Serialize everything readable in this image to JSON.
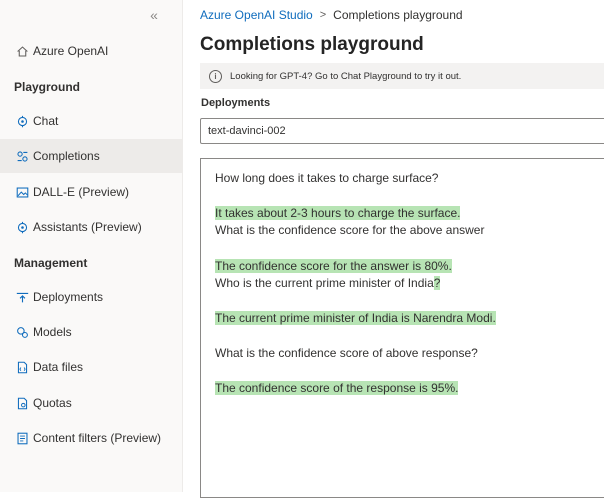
{
  "sidebar": {
    "collapse_glyph": "«",
    "top_item": {
      "label": "Azure OpenAI",
      "icon": "home-icon"
    },
    "sections": [
      {
        "title": "Playground",
        "items": [
          {
            "label": "Chat",
            "icon": "chat-icon"
          },
          {
            "label": "Completions",
            "icon": "completions-icon",
            "selected": true
          },
          {
            "label": "DALL-E (Preview)",
            "icon": "image-icon"
          },
          {
            "label": "Assistants (Preview)",
            "icon": "assistant-icon"
          }
        ]
      },
      {
        "title": "Management",
        "items": [
          {
            "label": "Deployments",
            "icon": "deployments-icon"
          },
          {
            "label": "Models",
            "icon": "models-icon"
          },
          {
            "label": "Data files",
            "icon": "data-files-icon"
          },
          {
            "label": "Quotas",
            "icon": "quotas-icon"
          },
          {
            "label": "Content filters (Preview)",
            "icon": "content-filters-icon"
          }
        ]
      }
    ]
  },
  "breadcrumb": {
    "root": "Azure OpenAI Studio",
    "separator": ">",
    "current": "Completions playground"
  },
  "page": {
    "title": "Completions playground"
  },
  "banner": {
    "icon_glyph": "i",
    "text": "Looking for GPT-4? Go to Chat Playground to try it out."
  },
  "deployments": {
    "label": "Deployments",
    "value": "text-davinci-002"
  },
  "editor": {
    "lines": [
      {
        "text": "How long does it takes to charge surface?",
        "highlighted": false
      },
      {
        "text": "It takes about 2-3 hours to charge the surface.",
        "highlighted": true
      },
      {
        "text": "What is the confidence score for the above answer",
        "highlighted": false
      },
      {
        "text": "The confidence score for the answer is 80%.",
        "highlighted": true
      },
      {
        "text": "Who is the current prime minister of India",
        "highlighted": false,
        "suffix": "?"
      },
      {
        "text": "The current prime minister of India is Narendra Modi.",
        "highlighted": true
      },
      {
        "text": "What is the confidence score of above response?",
        "highlighted": false
      },
      {
        "text": "The confidence score of the response is 95%.",
        "highlighted": true
      }
    ]
  },
  "colors": {
    "accent": "#0f6cbd",
    "highlight": "#b7e4b4",
    "selected_bg": "#edebe9"
  }
}
